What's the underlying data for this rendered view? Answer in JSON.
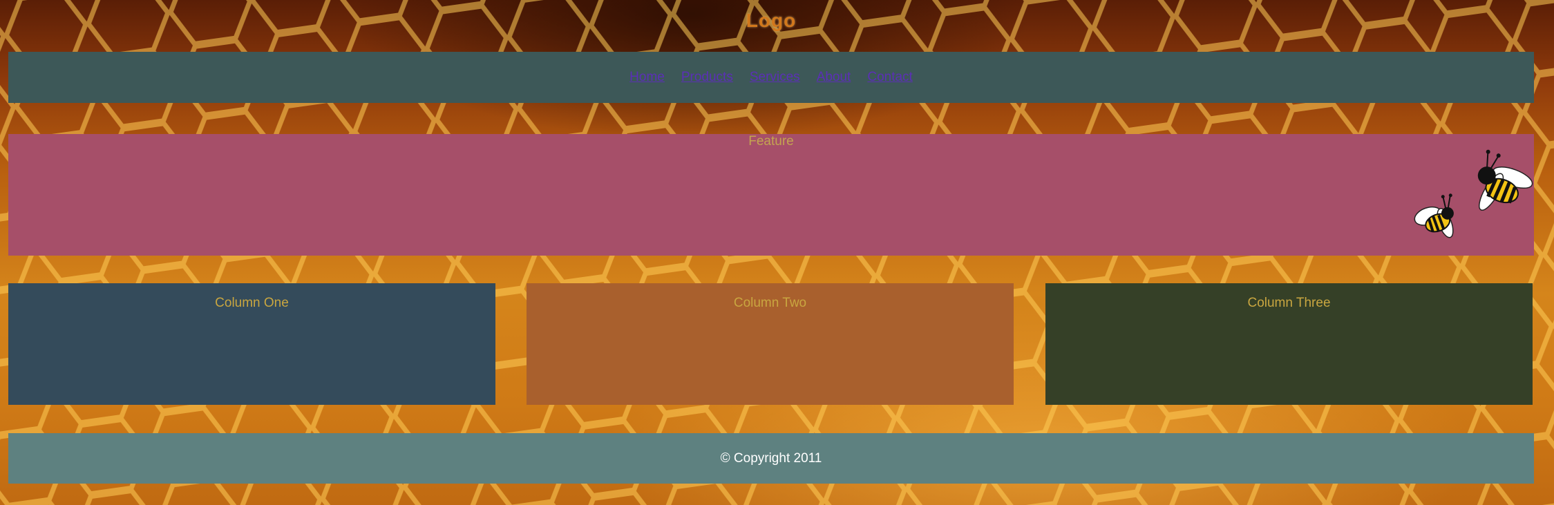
{
  "header": {
    "logo_text": "Logo"
  },
  "nav": {
    "items": [
      {
        "label": "Home"
      },
      {
        "label": "Products"
      },
      {
        "label": "Services"
      },
      {
        "label": "About"
      },
      {
        "label": "Contact"
      }
    ],
    "link_color": "#5b2fb6"
  },
  "feature": {
    "title": "Feature",
    "image": "bee-icon"
  },
  "columns": [
    {
      "title": "Column One"
    },
    {
      "title": "Column Two"
    },
    {
      "title": "Column Three"
    }
  ],
  "footer": {
    "text": "© Copyright 2011"
  },
  "colors": {
    "nav_bg": "#3d5858",
    "feature_bg": "#a64f69",
    "column_one_bg": "#344b5b",
    "column_two_bg": "#a9602d",
    "column_three_bg": "#354027",
    "footer_bg": "#5e8180",
    "heading_text": "#c9a640"
  },
  "background": {
    "image": "honeycomb-background"
  }
}
